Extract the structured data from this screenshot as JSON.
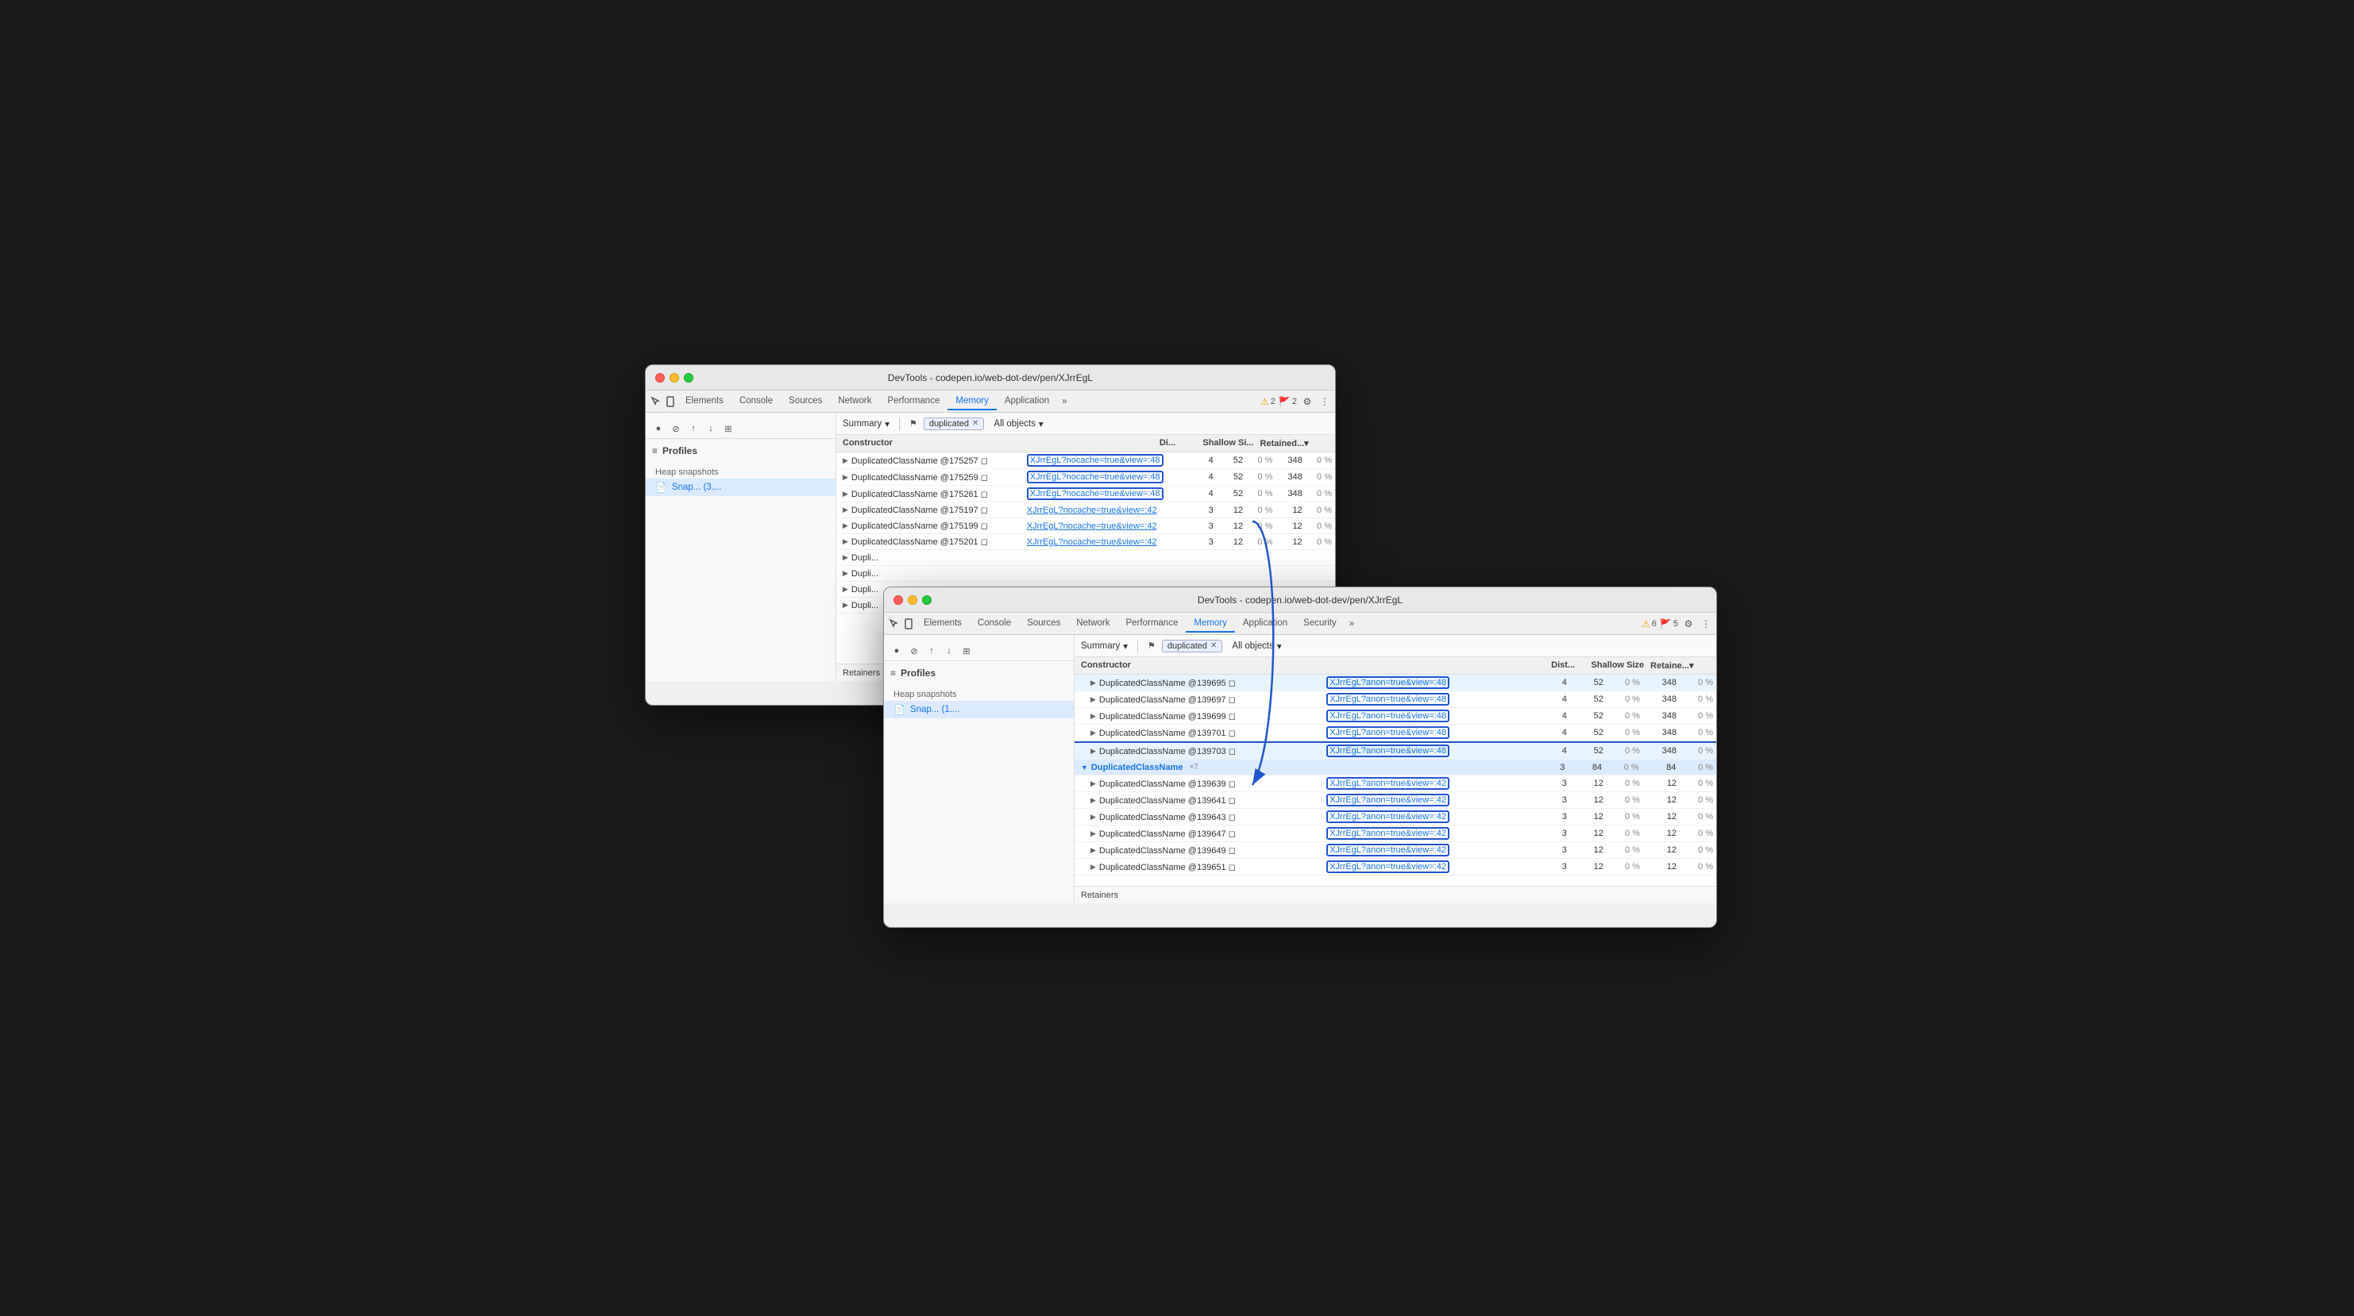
{
  "window_back": {
    "title": "DevTools - codepen.io/web-dot-dev/pen/XJrrEgL",
    "tabs": [
      "Elements",
      "Console",
      "Sources",
      "Network",
      "Performance",
      "Memory",
      "Application"
    ],
    "active_tab": "Memory",
    "more_icon": ">>",
    "alerts": [
      {
        "icon": "⚠",
        "count": "2"
      },
      {
        "icon": "🚩",
        "count": "2"
      }
    ],
    "filter_label": "Summary",
    "filter_tag": "duplicated",
    "objects_label": "All objects",
    "sidebar": {
      "profiles_title": "Profiles",
      "heap_section": "Heap snapshots",
      "snapshot_item": "Snap... (3...."
    },
    "table": {
      "headers": [
        "Constructor",
        "Di...",
        "Shallow Si...",
        "Retained..."
      ],
      "rows": [
        {
          "constructor": "DuplicatedClassName @175257",
          "link": "XJrrEgL?nocache=true&view=:48",
          "dist": "4",
          "shallow": "52",
          "shallow_pct": "0 %",
          "retained": "348",
          "retained_pct": "0 %",
          "boxed": true
        },
        {
          "constructor": "DuplicatedClassName @175259",
          "link": "XJrrEgL?nocache=true&view=:48",
          "dist": "4",
          "shallow": "52",
          "shallow_pct": "0 %",
          "retained": "348",
          "retained_pct": "0 %",
          "boxed": true
        },
        {
          "constructor": "DuplicatedClassName @175261",
          "link": "XJrrEgL?nocache=true&view=:48",
          "dist": "4",
          "shallow": "52",
          "shallow_pct": "0 %",
          "retained": "348",
          "retained_pct": "0 %",
          "boxed": true
        },
        {
          "constructor": "DuplicatedClassName @175197",
          "link": "XJrrEgL?nocache=true&view=:42",
          "dist": "3",
          "shallow": "12",
          "shallow_pct": "0 %",
          "retained": "12",
          "retained_pct": "0 %",
          "boxed": false
        },
        {
          "constructor": "DuplicatedClassName @175199",
          "link": "XJrrEgL?nocache=true&view=:42",
          "dist": "3",
          "shallow": "12",
          "shallow_pct": "0 %",
          "retained": "12",
          "retained_pct": "0 %",
          "boxed": false
        },
        {
          "constructor": "DuplicatedClassName @175201",
          "link": "XJrrEgL?nocache=true&view=:42",
          "dist": "3",
          "shallow": "12",
          "shallow_pct": "0 %",
          "retained": "12",
          "retained_pct": "0 %",
          "boxed": false
        },
        {
          "constructor": "Dupli...",
          "link": "",
          "dist": "",
          "shallow": "",
          "shallow_pct": "",
          "retained": "",
          "retained_pct": "",
          "boxed": false
        },
        {
          "constructor": "Dupli...",
          "link": "",
          "dist": "",
          "shallow": "",
          "shallow_pct": "",
          "retained": "",
          "retained_pct": "",
          "boxed": false
        },
        {
          "constructor": "Dupli...",
          "link": "",
          "dist": "",
          "shallow": "",
          "shallow_pct": "",
          "retained": "",
          "retained_pct": "",
          "boxed": false
        },
        {
          "constructor": "Dupli...",
          "link": "",
          "dist": "",
          "shallow": "",
          "shallow_pct": "",
          "retained": "",
          "retained_pct": "",
          "boxed": false
        }
      ]
    },
    "retainers_label": "Retainers"
  },
  "window_front": {
    "title": "DevTools - codepen.io/web-dot-dev/pen/XJrrEgL",
    "tabs": [
      "Elements",
      "Console",
      "Sources",
      "Network",
      "Performance",
      "Memory",
      "Application",
      "Security"
    ],
    "active_tab": "Memory",
    "more_icon": ">>",
    "alerts": [
      {
        "icon": "⚠",
        "count": "6"
      },
      {
        "icon": "🚩",
        "count": "5"
      }
    ],
    "filter_label": "Summary",
    "filter_tag": "duplicated",
    "objects_label": "All objects",
    "sidebar": {
      "profiles_title": "Profiles",
      "heap_section": "Heap snapshots",
      "snapshot_item": "Snap... (1...."
    },
    "table": {
      "headers": [
        "Constructor",
        "Dist...",
        "Shallow Size",
        "Retaine..."
      ],
      "rows": [
        {
          "constructor": "DuplicatedClassName @139695",
          "link": "XJrrEgL?anon=true&view=:48",
          "dist": "4",
          "shallow": "52",
          "shallow_pct": "0 %",
          "retained": "348",
          "retained_pct": "0 %",
          "boxed": true,
          "indent": 1
        },
        {
          "constructor": "DuplicatedClassName @139697",
          "link": "XJrrEgL?anon=true&view=:48",
          "dist": "4",
          "shallow": "52",
          "shallow_pct": "0 %",
          "retained": "348",
          "retained_pct": "0 %",
          "boxed": true,
          "indent": 1
        },
        {
          "constructor": "DuplicatedClassName @139699",
          "link": "XJrrEgL?anon=true&view=:48",
          "dist": "4",
          "shallow": "52",
          "shallow_pct": "0 %",
          "retained": "348",
          "retained_pct": "0 %",
          "boxed": true,
          "indent": 1
        },
        {
          "constructor": "DuplicatedClassName @139701",
          "link": "XJrrEgL?anon=true&view=:48",
          "dist": "4",
          "shallow": "52",
          "shallow_pct": "0 %",
          "retained": "348",
          "retained_pct": "0 %",
          "boxed": true,
          "indent": 1
        },
        {
          "constructor": "DuplicatedClassName @139703",
          "link": "XJrrEgL?anon=true&view=:48",
          "dist": "4",
          "shallow": "52",
          "shallow_pct": "0 %",
          "retained": "348",
          "retained_pct": "0 %",
          "boxed": true,
          "indent": 1
        },
        {
          "constructor": "DuplicatedClassName",
          "group_count": "×7",
          "link": "",
          "dist": "3",
          "shallow": "84",
          "shallow_pct": "0 %",
          "retained": "84",
          "retained_pct": "0 %",
          "boxed": false,
          "is_group": true,
          "indent": 0
        },
        {
          "constructor": "DuplicatedClassName @139639",
          "link": "XJrrEgL?anon=true&view=:42",
          "dist": "3",
          "shallow": "12",
          "shallow_pct": "0 %",
          "retained": "12",
          "retained_pct": "0 %",
          "boxed": true,
          "indent": 1
        },
        {
          "constructor": "DuplicatedClassName @139641",
          "link": "XJrrEgL?anon=true&view=:42",
          "dist": "3",
          "shallow": "12",
          "shallow_pct": "0 %",
          "retained": "12",
          "retained_pct": "0 %",
          "boxed": true,
          "indent": 1
        },
        {
          "constructor": "DuplicatedClassName @139643",
          "link": "XJrrEgL?anon=true&view=:42",
          "dist": "3",
          "shallow": "12",
          "shallow_pct": "0 %",
          "retained": "12",
          "retained_pct": "0 %",
          "boxed": true,
          "indent": 1
        },
        {
          "constructor": "DuplicatedClassName @139647",
          "link": "XJrrEgL?anon=true&view=:42",
          "dist": "3",
          "shallow": "12",
          "shallow_pct": "0 %",
          "retained": "12",
          "retained_pct": "0 %",
          "boxed": true,
          "indent": 1
        },
        {
          "constructor": "DuplicatedClassName @139649",
          "link": "XJrrEgL?anon=true&view=:42",
          "dist": "3",
          "shallow": "12",
          "shallow_pct": "0 %",
          "retained": "12",
          "retained_pct": "0 %",
          "boxed": true,
          "indent": 1
        },
        {
          "constructor": "DuplicatedClassName @139651",
          "link": "XJrrEgL?anon=true&view=:42",
          "dist": "3",
          "shallow": "12",
          "shallow_pct": "0 %",
          "retained": "12",
          "retained_pct": "0 %",
          "boxed": true,
          "indent": 1
        }
      ]
    },
    "retainers_label": "Retainers"
  }
}
